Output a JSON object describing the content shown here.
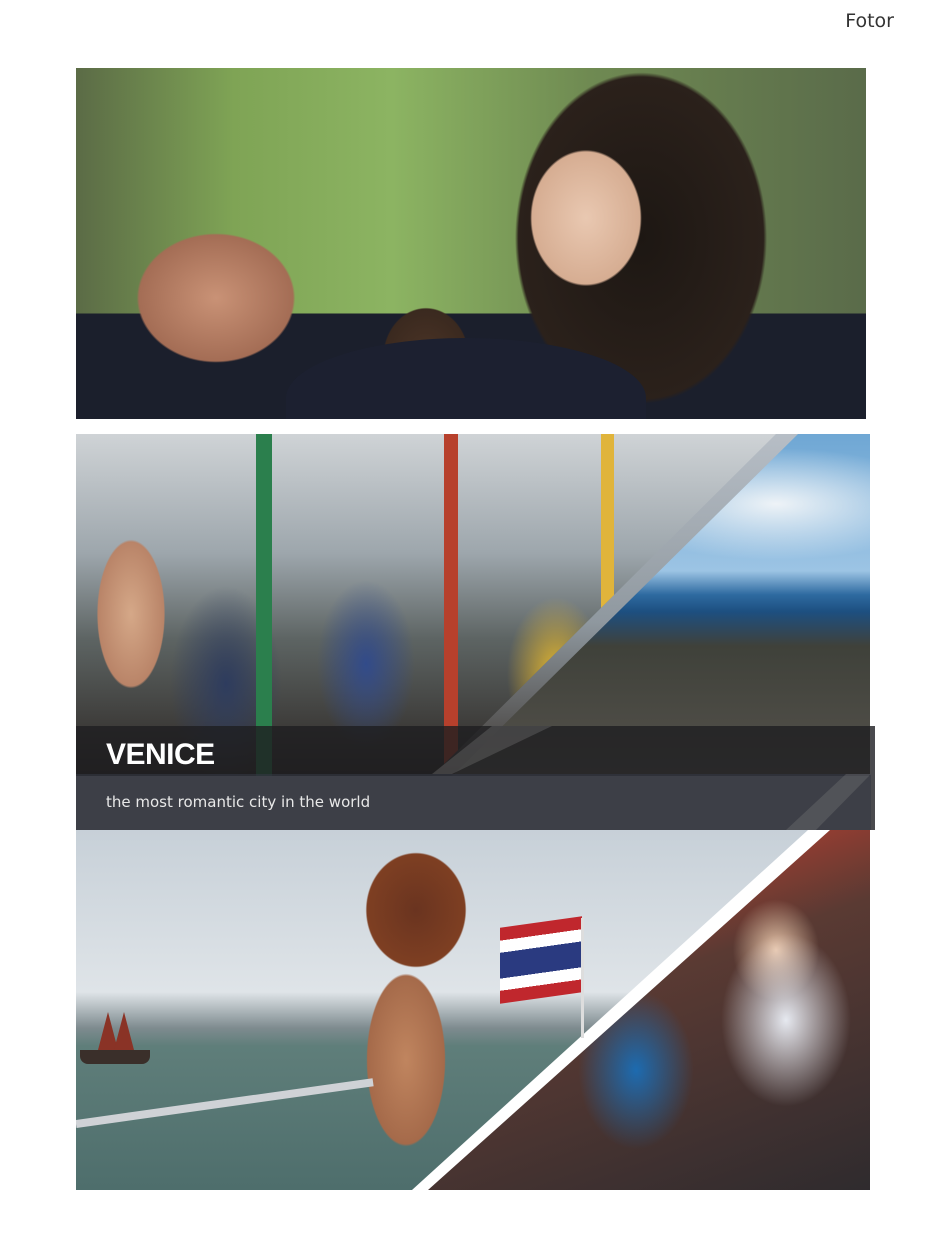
{
  "brand": "Fotor",
  "caption": {
    "title": "VENICE",
    "subtitle": "the most romantic city in the world"
  },
  "photos": [
    {
      "name": "girl-with-monkey-photo"
    },
    {
      "name": "group-photo-collage"
    },
    {
      "name": "boat-and-group-photo-collage"
    }
  ]
}
